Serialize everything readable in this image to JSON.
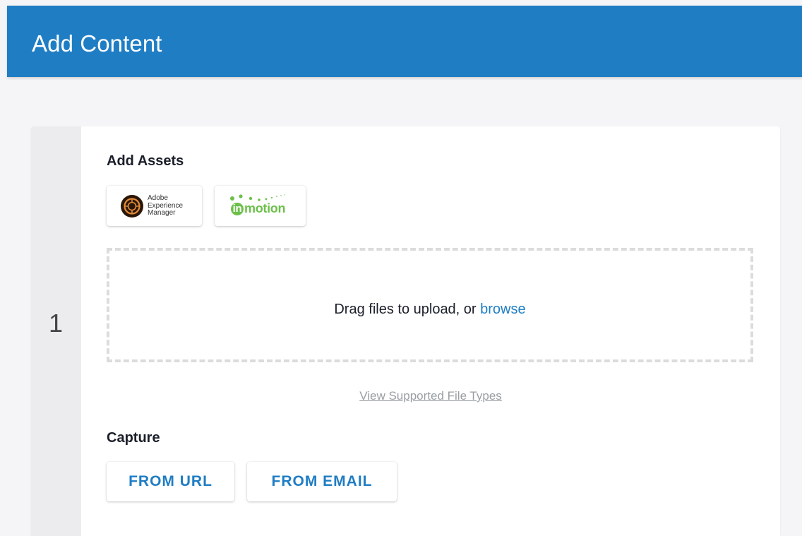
{
  "header": {
    "title": "Add Content"
  },
  "step": {
    "number": "1"
  },
  "assets": {
    "title": "Add Assets",
    "integrations": [
      {
        "name": "Adobe Experience Manager",
        "lines": [
          "Adobe",
          "Experience",
          "Manager"
        ],
        "icon": "aem-logo-icon"
      },
      {
        "name": "inmotion",
        "in_text": "in",
        "rest_text": "motion",
        "icon": "inmotion-logo-icon",
        "color": "#6cc04a"
      }
    ],
    "dropzone": {
      "text": "Drag files to upload, or ",
      "link": "browse"
    },
    "supported_link": "View Supported File Types"
  },
  "capture": {
    "title": "Capture",
    "buttons": [
      "FROM URL",
      "FROM EMAIL"
    ]
  },
  "colors": {
    "accent": "#1f7dc4",
    "background": "#f5f5f7"
  }
}
